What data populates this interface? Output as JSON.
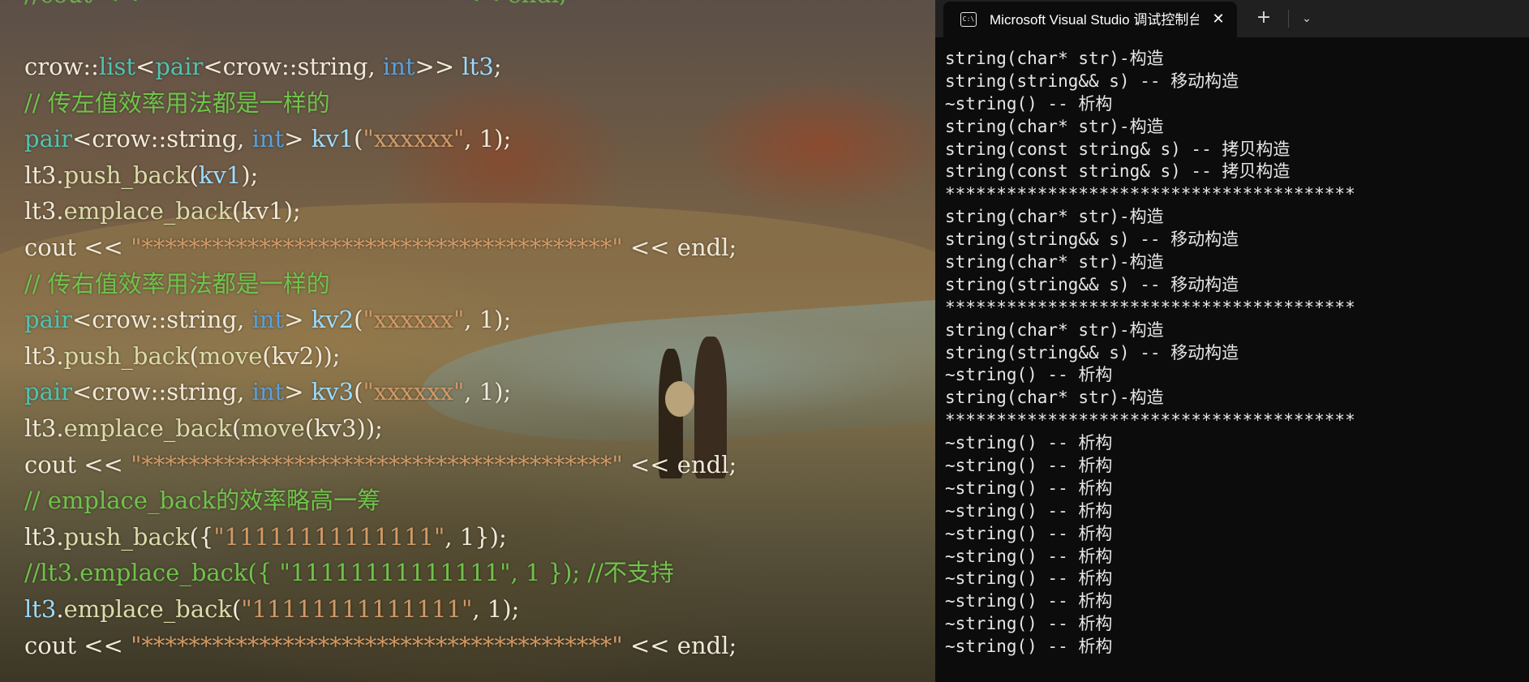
{
  "editor": {
    "partial_top_line": "//cout <<                                           << endl;",
    "code_lines": [
      [
        [
          "crow::",
          ""
        ],
        [
          "list",
          "tp"
        ],
        [
          "<",
          ""
        ],
        [
          "pair",
          "tp"
        ],
        [
          "<crow::string, ",
          ""
        ],
        [
          "int",
          "kw"
        ],
        [
          ">> ",
          ""
        ],
        [
          "lt3",
          "vr"
        ],
        [
          ";",
          ""
        ]
      ],
      [
        [
          "// 传左值效率用法都是一样的",
          "cm"
        ]
      ],
      [
        [
          "pair",
          "tp"
        ],
        [
          "<crow::string, ",
          ""
        ],
        [
          "int",
          "kw"
        ],
        [
          "> ",
          ""
        ],
        [
          "kv1",
          "vr"
        ],
        [
          "(",
          ""
        ],
        [
          "\"xxxxxx\"",
          "st"
        ],
        [
          ", 1);",
          ""
        ]
      ],
      [
        [
          "lt3.",
          ""
        ],
        [
          "push_back",
          "fn"
        ],
        [
          "(",
          ""
        ],
        [
          "kv1",
          "vr"
        ],
        [
          ");",
          ""
        ]
      ],
      [
        [
          "lt3.",
          ""
        ],
        [
          "emplace_back",
          "fn"
        ],
        [
          "(kv1);",
          ""
        ]
      ],
      [
        [
          "cout << ",
          ""
        ],
        [
          "\"****************************************\"",
          "st"
        ],
        [
          " << endl;",
          ""
        ]
      ],
      [
        [
          "// 传右值效率用法都是一样的",
          "cm"
        ]
      ],
      [
        [
          "pair",
          "tp"
        ],
        [
          "<crow::string, ",
          ""
        ],
        [
          "int",
          "kw"
        ],
        [
          "> ",
          ""
        ],
        [
          "kv2",
          "vr"
        ],
        [
          "(",
          ""
        ],
        [
          "\"xxxxxx\"",
          "st"
        ],
        [
          ", 1);",
          ""
        ]
      ],
      [
        [
          "lt3.",
          ""
        ],
        [
          "push_back",
          "fn"
        ],
        [
          "(",
          ""
        ],
        [
          "move",
          "fn"
        ],
        [
          "(kv2));",
          ""
        ]
      ],
      [
        [
          "pair",
          "tp"
        ],
        [
          "<crow::string, ",
          ""
        ],
        [
          "int",
          "kw"
        ],
        [
          "> ",
          ""
        ],
        [
          "kv3",
          "vr"
        ],
        [
          "(",
          ""
        ],
        [
          "\"xxxxxx\"",
          "st"
        ],
        [
          ", 1);",
          ""
        ]
      ],
      [
        [
          "lt3.",
          ""
        ],
        [
          "emplace_back",
          "fn"
        ],
        [
          "(",
          ""
        ],
        [
          "move",
          "fn"
        ],
        [
          "(kv3));",
          ""
        ]
      ],
      [
        [
          "cout << ",
          ""
        ],
        [
          "\"****************************************\"",
          "st"
        ],
        [
          " << endl;",
          ""
        ]
      ],
      [
        [
          "// emplace_back的效率略高一筹",
          "cm"
        ]
      ],
      [
        [
          "lt3.",
          ""
        ],
        [
          "push_back",
          "fn"
        ],
        [
          "({",
          ""
        ],
        [
          "\"11111111111111\"",
          "st"
        ],
        [
          ", 1});",
          ""
        ]
      ],
      [
        [
          "//lt3.emplace_back({ \"11111111111111\", 1 }); //不支持",
          "cm"
        ]
      ],
      [
        [
          "lt3",
          "vr"
        ],
        [
          ".",
          ""
        ],
        [
          "emplace_back",
          "fn"
        ],
        [
          "(",
          ""
        ],
        [
          "\"11111111111111\"",
          "st"
        ],
        [
          ", 1);",
          ""
        ]
      ],
      [
        [
          "cout << ",
          ""
        ],
        [
          "\"****************************************\"",
          "st"
        ],
        [
          " << endl;",
          ""
        ]
      ]
    ],
    "colors": {
      "comment": "#6fc34a",
      "keyword": "#5aa0dc",
      "type": "#4fc3b1",
      "string": "#d19a66",
      "function": "#dcdcaa",
      "variable": "#9cdcfe",
      "default": "#f1ead9"
    }
  },
  "terminal": {
    "tab": {
      "icon": "console-icon",
      "icon_glyph": "C:\\",
      "title": "Microsoft Visual Studio 调试控制台",
      "close_glyph": "✕"
    },
    "new_tab_glyph": "+",
    "dropdown_glyph": "⌄",
    "output_lines": [
      "string(char* str)-构造",
      "string(string&& s) -- 移动构造",
      "~string() -- 析构",
      "string(char* str)-构造",
      "string(const string& s) -- 拷贝构造",
      "string(const string& s) -- 拷贝构造",
      "****************************************",
      "string(char* str)-构造",
      "string(string&& s) -- 移动构造",
      "string(char* str)-构造",
      "string(string&& s) -- 移动构造",
      "****************************************",
      "string(char* str)-构造",
      "string(string&& s) -- 移动构造",
      "~string() -- 析构",
      "string(char* str)-构造",
      "****************************************",
      "~string() -- 析构",
      "~string() -- 析构",
      "~string() -- 析构",
      "~string() -- 析构",
      "~string() -- 析构",
      "~string() -- 析构",
      "~string() -- 析构",
      "~string() -- 析构",
      "~string() -- 析构",
      "~string() -- 析构"
    ],
    "colors": {
      "background": "#0c0c0c",
      "text": "#e6e6e6",
      "tabbar": "#202020"
    }
  }
}
